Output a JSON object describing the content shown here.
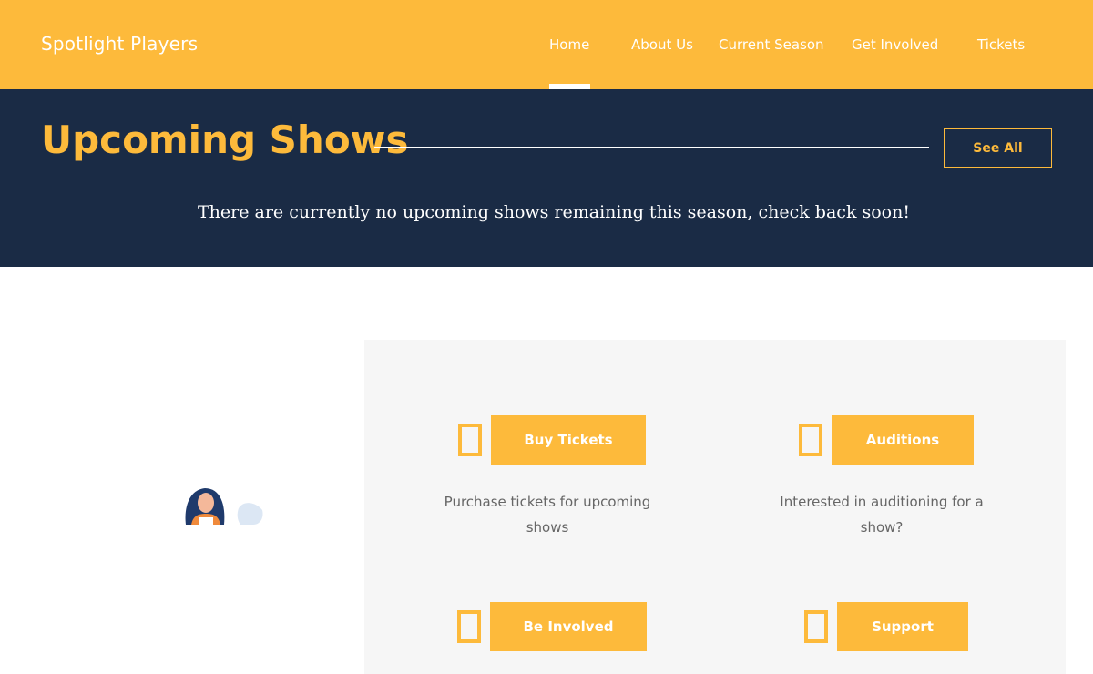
{
  "header": {
    "brand": "Spotlight Players",
    "nav": [
      "Home",
      "About Us",
      "Current Season",
      "Get Involved",
      "Tickets"
    ],
    "active_nav": "Home"
  },
  "hero": {
    "title": "Upcoming Shows",
    "see_all": "See All",
    "message": "There are currently no upcoming shows remaining this season, check back soon!"
  },
  "cards": [
    {
      "button": "Buy Tickets",
      "description": "Purchase tickets for upcoming shows"
    },
    {
      "button": "Auditions",
      "description": "Interested in auditioning for a show?"
    },
    {
      "button": "Be Involved",
      "description": ""
    },
    {
      "button": "Support",
      "description": ""
    }
  ],
  "colors": {
    "accent": "#FDBA3B",
    "navy": "#1A2B45",
    "panel_bg": "#F6F6F6"
  },
  "icons": [
    "ticket-icon",
    "auditions-icon",
    "involved-icon",
    "support-icon"
  ]
}
